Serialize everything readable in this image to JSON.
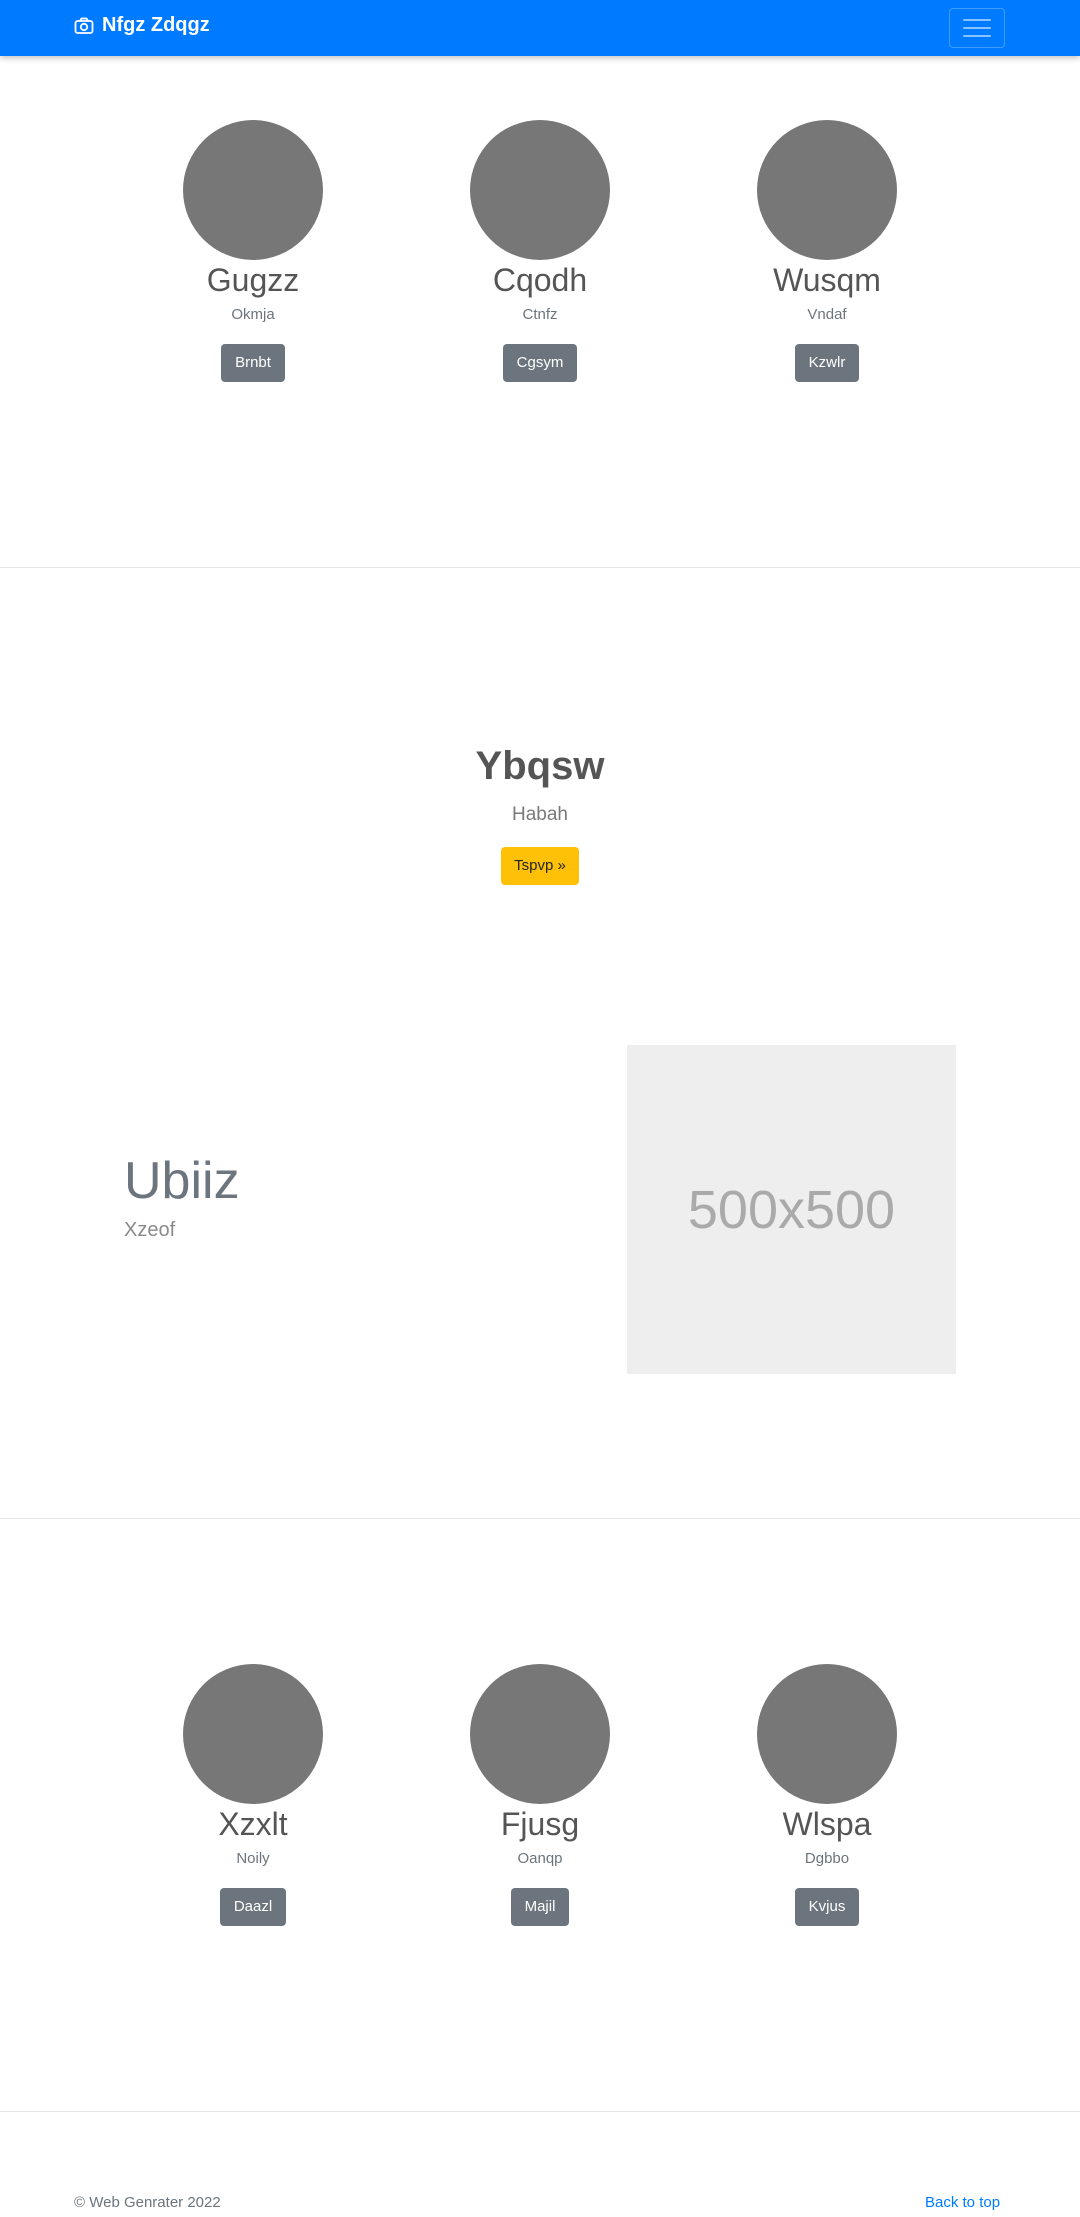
{
  "navbar": {
    "brand": "Nfgz Zdqgz",
    "brand_icon": "camera-icon",
    "color": "#007bff"
  },
  "team_top": [
    {
      "name": "Gugzz",
      "subtitle": "Okmja",
      "button": "Brnbt"
    },
    {
      "name": "Cqodh",
      "subtitle": "Ctnfz",
      "button": "Cgsym"
    },
    {
      "name": "Wusqm",
      "subtitle": "Vndaf",
      "button": "Kzwlr"
    }
  ],
  "hero": {
    "title": "Ybqsw",
    "subtitle": "Habah",
    "button": "Tspvp »"
  },
  "feature": {
    "title": "Ubiiz",
    "subtitle": "Xzeof",
    "image_label": "500x500"
  },
  "team_bottom": [
    {
      "name": "Xzxlt",
      "subtitle": "Noily",
      "button": "Daazl"
    },
    {
      "name": "Fjusg",
      "subtitle": "Oanqp",
      "button": "Majil"
    },
    {
      "name": "Wlspa",
      "subtitle": "Dgbbo",
      "button": "Kvjus"
    }
  ],
  "footer": {
    "copyright": "© Web Genrater 2022",
    "back_to_top": "Back to top"
  }
}
